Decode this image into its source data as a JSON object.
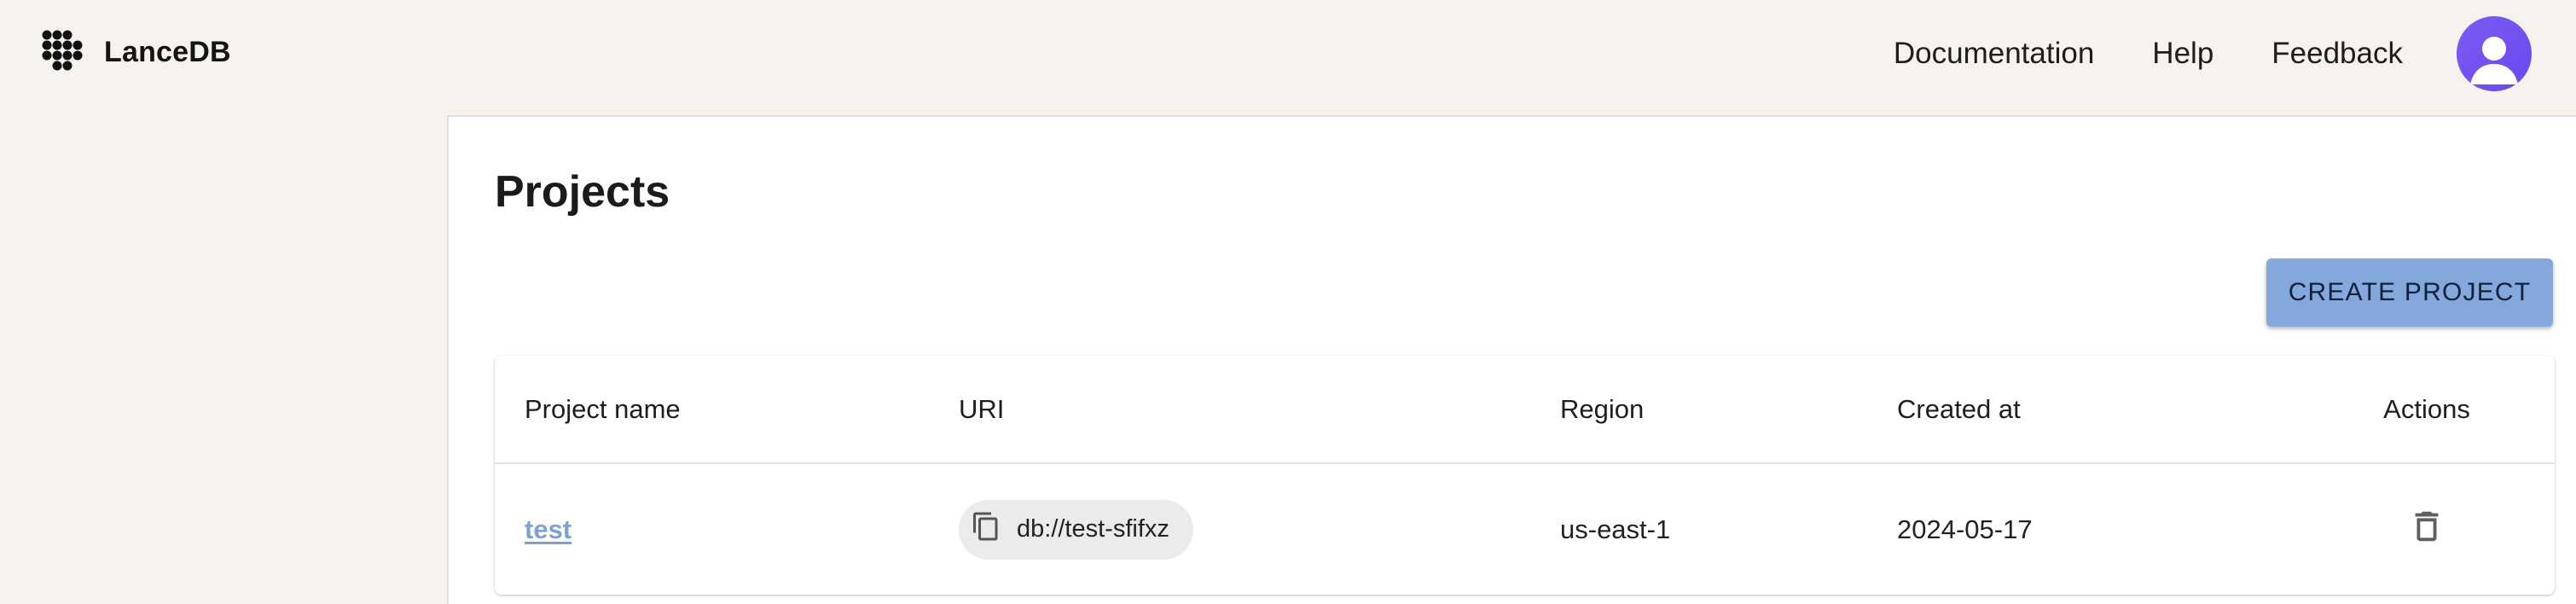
{
  "header": {
    "brand": "LanceDB",
    "nav": [
      "Documentation",
      "Help",
      "Feedback"
    ]
  },
  "main": {
    "title": "Projects",
    "create_button": "CREATE PROJECT",
    "table": {
      "columns": [
        "Project name",
        "URI",
        "Region",
        "Created at",
        "Actions"
      ],
      "rows": [
        {
          "name": "test",
          "uri": "db://test-sfifxz",
          "region": "us-east-1",
          "created": "2024-05-17"
        }
      ]
    }
  },
  "colors": {
    "page_bg": "#f6f3ef",
    "accent_button": "#84a7dc",
    "link": "#7ea0d8",
    "avatar": "#6b47ee"
  },
  "icons": {
    "logo": "lancedb-logo-icon",
    "avatar": "user-avatar-icon",
    "copy": "copy-icon",
    "delete": "trash-icon"
  }
}
